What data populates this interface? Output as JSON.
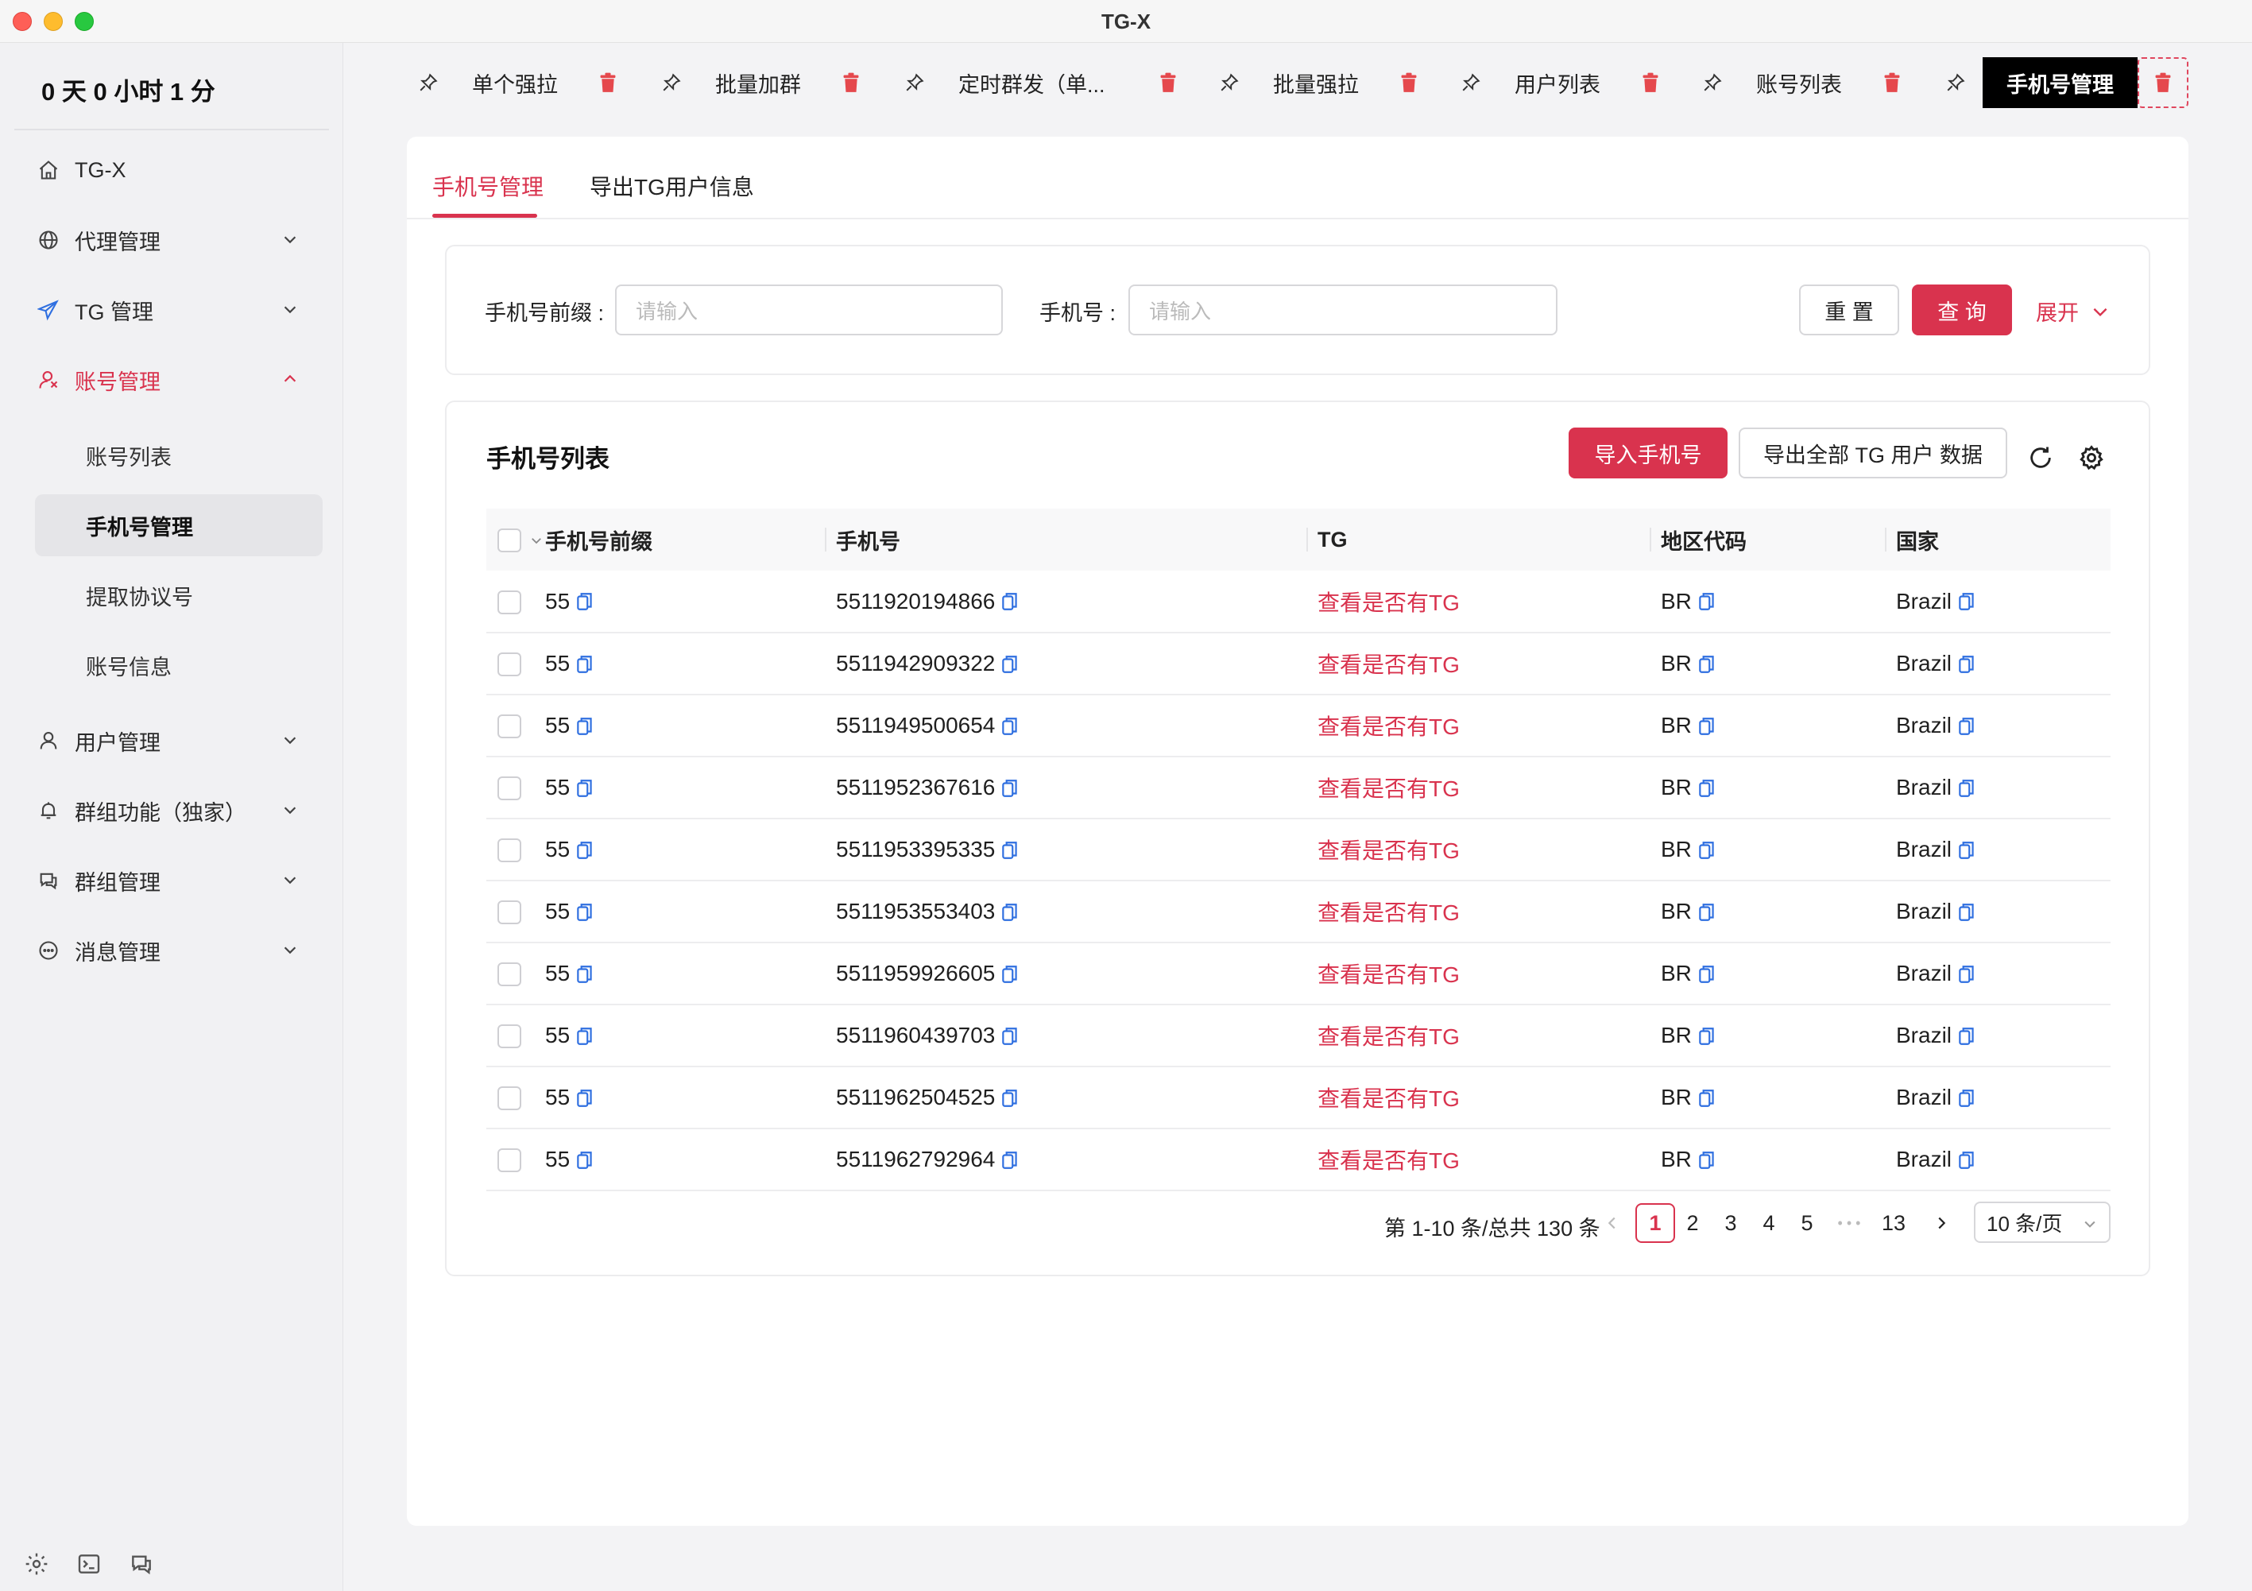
{
  "window": {
    "title": "TG-X"
  },
  "sidebar": {
    "uptime": "0 天 0 小时 1 分",
    "items": [
      {
        "label": "TG-X",
        "icon": "home-icon"
      },
      {
        "label": "代理管理",
        "icon": "globe-icon"
      },
      {
        "label": "TG 管理",
        "icon": "send-icon"
      },
      {
        "label": "账号管理",
        "icon": "account-icon",
        "expanded": true
      },
      {
        "label": "用户管理",
        "icon": "user-icon"
      },
      {
        "label": "群组功能（独家）",
        "icon": "bell-icon"
      },
      {
        "label": "群组管理",
        "icon": "chat-icon"
      },
      {
        "label": "消息管理",
        "icon": "message-icon"
      }
    ],
    "subitems": [
      {
        "label": "账号列表"
      },
      {
        "label": "手机号管理",
        "selected": true
      },
      {
        "label": "提取协议号"
      },
      {
        "label": "账号信息"
      }
    ]
  },
  "tabs": [
    {
      "label": "单个强拉"
    },
    {
      "label": "批量加群"
    },
    {
      "label": "定时群发（单..."
    },
    {
      "label": "批量强拉"
    },
    {
      "label": "用户列表"
    },
    {
      "label": "账号列表"
    },
    {
      "label": "手机号管理",
      "active": true
    }
  ],
  "subtabs": [
    {
      "label": "手机号管理",
      "active": true
    },
    {
      "label": "导出TG用户信息"
    }
  ],
  "search": {
    "prefix_label": "手机号前缀 :",
    "prefix_placeholder": "请输入",
    "phone_label": "手机号 :",
    "phone_placeholder": "请输入",
    "reset": "重 置",
    "query": "查 询",
    "expand": "展开"
  },
  "list": {
    "title": "手机号列表",
    "import_btn": "导入手机号",
    "export_btn": "导出全部 TG 用户 数据",
    "columns": [
      "手机号前缀",
      "手机号",
      "TG",
      "地区代码",
      "国家"
    ],
    "link_text": "查看是否有TG",
    "rows": [
      {
        "prefix": "55",
        "phone": "5511920194866",
        "region": "BR",
        "country": "Brazil"
      },
      {
        "prefix": "55",
        "phone": "5511942909322",
        "region": "BR",
        "country": "Brazil"
      },
      {
        "prefix": "55",
        "phone": "5511949500654",
        "region": "BR",
        "country": "Brazil"
      },
      {
        "prefix": "55",
        "phone": "5511952367616",
        "region": "BR",
        "country": "Brazil"
      },
      {
        "prefix": "55",
        "phone": "5511953395335",
        "region": "BR",
        "country": "Brazil"
      },
      {
        "prefix": "55",
        "phone": "5511953553403",
        "region": "BR",
        "country": "Brazil"
      },
      {
        "prefix": "55",
        "phone": "5511959926605",
        "region": "BR",
        "country": "Brazil"
      },
      {
        "prefix": "55",
        "phone": "5511960439703",
        "region": "BR",
        "country": "Brazil"
      },
      {
        "prefix": "55",
        "phone": "5511962504525",
        "region": "BR",
        "country": "Brazil"
      },
      {
        "prefix": "55",
        "phone": "5511962792964",
        "region": "BR",
        "country": "Brazil"
      }
    ]
  },
  "pagination": {
    "total_text": "第 1-10 条/总共 130 条",
    "pages": [
      "1",
      "2",
      "3",
      "4",
      "5"
    ],
    "ellipsis": "• • •",
    "last": "13",
    "current": "1",
    "page_size": "10 条/页"
  },
  "colors": {
    "accent": "#d9334e",
    "copy_icon": "#2f6fe0"
  }
}
